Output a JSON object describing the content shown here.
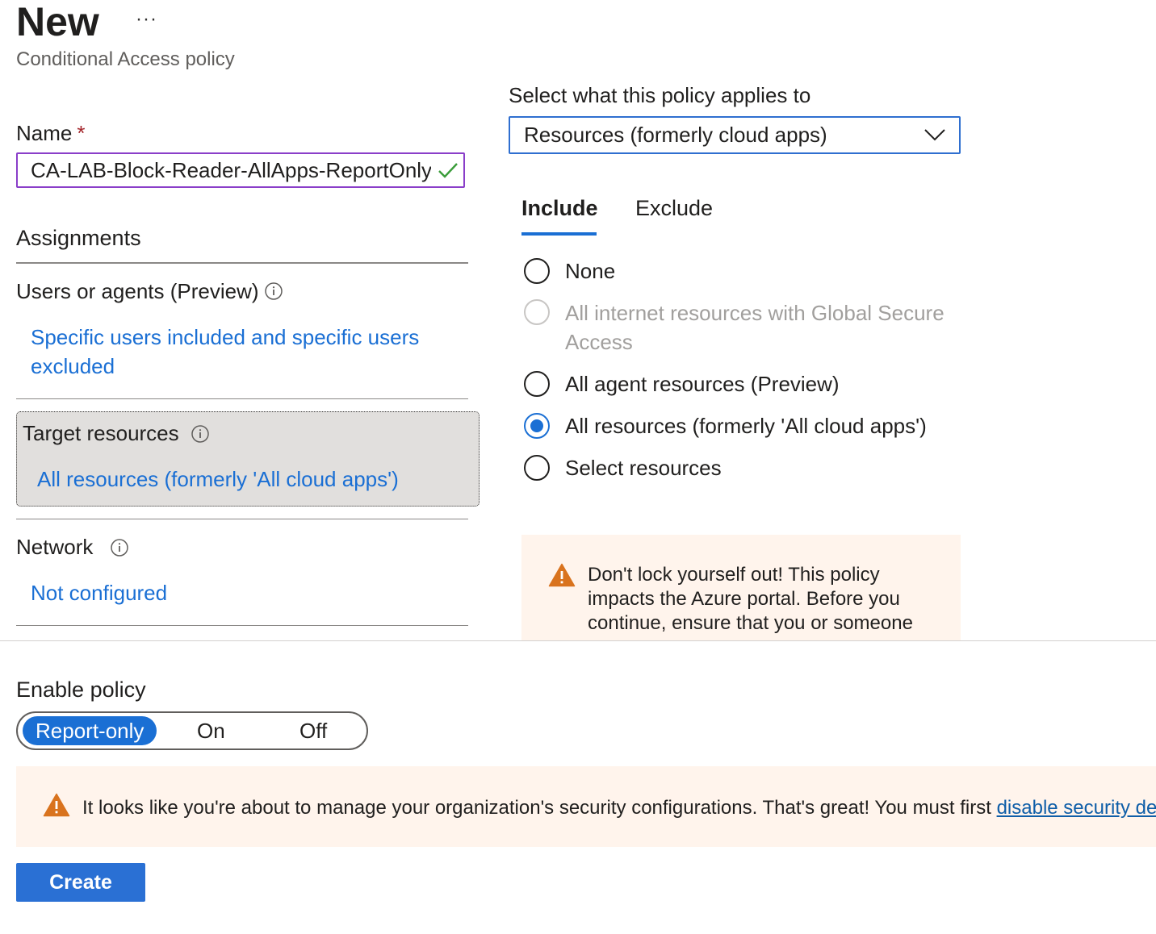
{
  "header": {
    "title": "New",
    "more_label": "···",
    "subtitle": "Conditional Access policy"
  },
  "name_field": {
    "label": "Name",
    "required_mark": "*",
    "value": "CA-LAB-Block-Reader-AllApps-ReportOnly"
  },
  "assignments": {
    "heading": "Assignments",
    "users": {
      "label": "Users or agents (Preview)",
      "line1": "Specific users included and specific users",
      "line2": "excluded"
    },
    "target_resources": {
      "label": "Target resources",
      "value": "All resources (formerly 'All cloud apps')"
    },
    "network": {
      "label": "Network",
      "value": "Not configured"
    }
  },
  "applies_to": {
    "label": "Select what this policy applies to",
    "selected": "Resources (formerly cloud apps)"
  },
  "tabs": [
    {
      "label": "Include",
      "active": true
    },
    {
      "label": "Exclude",
      "active": false
    }
  ],
  "include_options": {
    "none": "None",
    "internet_line1": "All internet resources with Global Secure",
    "internet_line2": "Access",
    "agent": "All agent resources (Preview)",
    "all": "All resources (formerly 'All cloud apps')",
    "select": "Select resources",
    "selected": "all"
  },
  "lockout_warning": {
    "line1": "Don't lock yourself out! This policy",
    "line2": "impacts the Azure portal. Before you",
    "line3": "continue, ensure that you or someone"
  },
  "enable_policy": {
    "label": "Enable policy",
    "options": [
      "Report-only",
      "On",
      "Off"
    ],
    "selected": "Report-only"
  },
  "security_banner": {
    "text": "It looks like you're about to manage your organization's security configurations. That's great! You must first ",
    "link": "disable security defaults"
  },
  "create_label": "Create",
  "colors": {
    "accent": "#1a6fd4",
    "warning": "#d9731e",
    "warning_bg": "#fff4ec",
    "valid": "#3a9c3a",
    "name_border": "#8a3ec9"
  }
}
